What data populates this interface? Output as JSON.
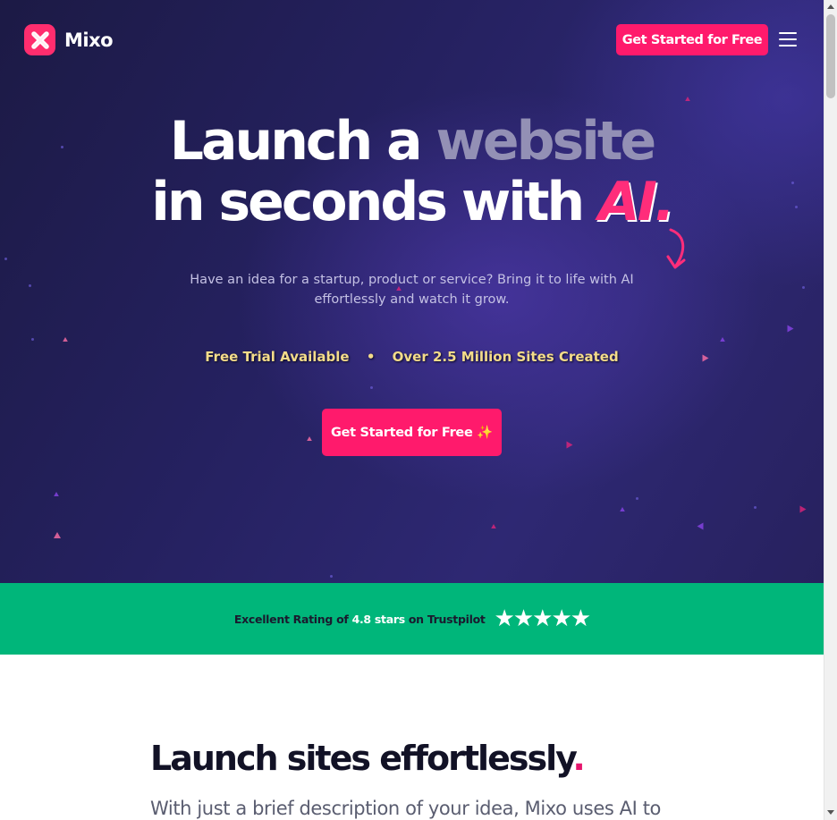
{
  "header": {
    "brand": "Mixo",
    "cta_label": "Get Started for Free"
  },
  "hero": {
    "headline_line1_a": "Launch a ",
    "headline_line1_b": "website",
    "headline_line2_a": "in seconds with ",
    "headline_line2_b": "AI.",
    "subtext_line1": "Have an idea for a startup, product or service? Bring it to life with AI",
    "subtext_line2": "effortlessly and watch it grow.",
    "badge_1": "Free Trial Available",
    "badge_separator": "•",
    "badge_2": "Over 2.5 Million Sites Created",
    "cta_label": "Get Started for Free ✨"
  },
  "trust": {
    "text_a": "Excellent Rating of ",
    "text_b": "4.8 stars",
    "text_c": " on Trustpilot",
    "stars": "★★★★★",
    "rating": 4.8
  },
  "section": {
    "title": "Launch sites effortlessly",
    "title_accent": ".",
    "body": "With just a brief description of your idea, Mixo uses AI to"
  },
  "colors": {
    "accent": "#ff1a6c",
    "hero_bg": "#252160",
    "trust_bg": "#00b67a",
    "badge_text": "#f4dc8a"
  },
  "icons": {
    "logo": "mixo-x-logo-icon",
    "menu": "hamburger-menu-icon",
    "arrow": "curved-arrow-icon",
    "stars": "star-icon"
  }
}
